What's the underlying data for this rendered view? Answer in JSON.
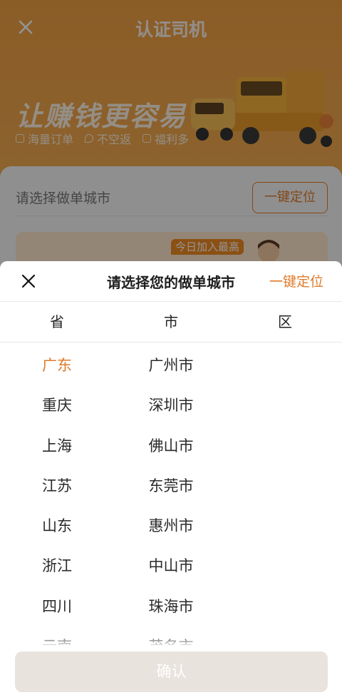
{
  "background_page": {
    "title": "认证司机",
    "banner": {
      "slogan": "让赚钱更容易",
      "tags": [
        {
          "icon": "order-icon",
          "label": "海量订单"
        },
        {
          "icon": "location-pin-icon",
          "label": "不空返"
        },
        {
          "icon": "gift-bag-icon",
          "label": "福利多"
        }
      ]
    },
    "city_field": {
      "placeholder": "请选择做单城市",
      "locate_label": "一键定位"
    },
    "promo": {
      "pill_text": "今日加入最高"
    }
  },
  "sheet": {
    "title": "请选择您的做单城市",
    "locate_label": "一键定位",
    "columns": [
      "省",
      "市",
      "区"
    ],
    "provinces": [
      "广东",
      "重庆",
      "上海",
      "江苏",
      "山东",
      "浙江",
      "四川",
      "云南"
    ],
    "selected_province": "广东",
    "cities": [
      "广州市",
      "深圳市",
      "佛山市",
      "东莞市",
      "惠州市",
      "中山市",
      "珠海市",
      "茂名市"
    ],
    "confirm_label": "确认"
  },
  "colors": {
    "accent": "#e07a2a",
    "banner_orange": "#f0a043",
    "confirm_disabled": "#e9e3dd"
  }
}
